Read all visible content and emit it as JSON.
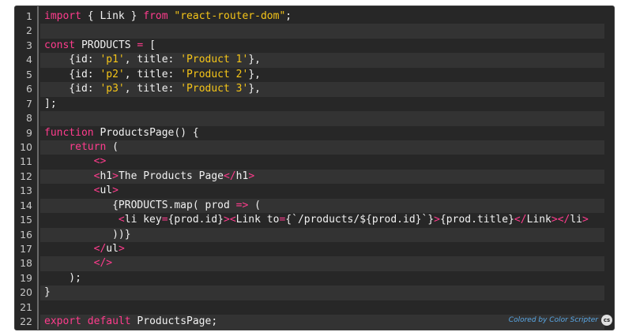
{
  "colors": {
    "background": "#272727",
    "keyword": "#ff3c8d",
    "string": "#f5c518",
    "text": "#f1f1f1",
    "line_number": "#c8c8c8",
    "credit": "#5aa8e6"
  },
  "lines": [
    {
      "n": "1",
      "tokens": [
        [
          "kw",
          "import"
        ],
        [
          "txt",
          " { Link } "
        ],
        [
          "kw",
          "from"
        ],
        [
          "txt",
          " "
        ],
        [
          "str",
          "\"react-router-dom\""
        ],
        [
          "txt",
          ";"
        ]
      ]
    },
    {
      "n": "2",
      "tokens": []
    },
    {
      "n": "3",
      "tokens": [
        [
          "kw",
          "const"
        ],
        [
          "txt",
          " PRODUCTS "
        ],
        [
          "op",
          "="
        ],
        [
          "txt",
          " ["
        ]
      ]
    },
    {
      "n": "4",
      "tokens": [
        [
          "txt",
          "    {id: "
        ],
        [
          "str",
          "'p1'"
        ],
        [
          "txt",
          ", title: "
        ],
        [
          "str",
          "'Product 1'"
        ],
        [
          "txt",
          "},"
        ]
      ]
    },
    {
      "n": "5",
      "tokens": [
        [
          "txt",
          "    {id: "
        ],
        [
          "str",
          "'p2'"
        ],
        [
          "txt",
          ", title: "
        ],
        [
          "str",
          "'Product 2'"
        ],
        [
          "txt",
          "},"
        ]
      ]
    },
    {
      "n": "6",
      "tokens": [
        [
          "txt",
          "    {id: "
        ],
        [
          "str",
          "'p3'"
        ],
        [
          "txt",
          ", title: "
        ],
        [
          "str",
          "'Product 3'"
        ],
        [
          "txt",
          "},"
        ]
      ]
    },
    {
      "n": "7",
      "tokens": [
        [
          "txt",
          "];"
        ]
      ]
    },
    {
      "n": "8",
      "tokens": []
    },
    {
      "n": "9",
      "tokens": [
        [
          "kw",
          "function"
        ],
        [
          "txt",
          " ProductsPage() {"
        ]
      ]
    },
    {
      "n": "10",
      "tokens": [
        [
          "txt",
          "    "
        ],
        [
          "kw",
          "return"
        ],
        [
          "txt",
          " ("
        ]
      ]
    },
    {
      "n": "11",
      "tokens": [
        [
          "txt",
          "        "
        ],
        [
          "op",
          "<>"
        ]
      ]
    },
    {
      "n": "12",
      "tokens": [
        [
          "txt",
          "        "
        ],
        [
          "op",
          "<"
        ],
        [
          "txt",
          "h1"
        ],
        [
          "op",
          ">"
        ],
        [
          "txt",
          "The Products Page"
        ],
        [
          "op",
          "</"
        ],
        [
          "txt",
          "h1"
        ],
        [
          "op",
          ">"
        ]
      ]
    },
    {
      "n": "13",
      "tokens": [
        [
          "txt",
          "        "
        ],
        [
          "op",
          "<"
        ],
        [
          "txt",
          "ul"
        ],
        [
          "op",
          ">"
        ]
      ]
    },
    {
      "n": "14",
      "tokens": [
        [
          "txt",
          "           {PRODUCTS.map( prod "
        ],
        [
          "op",
          "=>"
        ],
        [
          "txt",
          " ("
        ]
      ]
    },
    {
      "n": "15",
      "tokens": [
        [
          "txt",
          "            "
        ],
        [
          "op",
          "<"
        ],
        [
          "txt",
          "li key"
        ],
        [
          "op",
          "="
        ],
        [
          "txt",
          "{prod.id}"
        ],
        [
          "op",
          "><"
        ],
        [
          "txt",
          "Link to"
        ],
        [
          "op",
          "="
        ],
        [
          "txt",
          "{`"
        ],
        [
          "txt",
          "/products/"
        ],
        [
          "txt",
          "${prod.id}"
        ],
        [
          "txt",
          "`}"
        ],
        [
          "op",
          ">"
        ],
        [
          "txt",
          "{prod.title}"
        ],
        [
          "op",
          "</"
        ],
        [
          "txt",
          "Link"
        ],
        [
          "op",
          "></"
        ],
        [
          "txt",
          "li"
        ],
        [
          "op",
          ">"
        ]
      ]
    },
    {
      "n": "16",
      "tokens": [
        [
          "txt",
          "           ))}"
        ]
      ]
    },
    {
      "n": "17",
      "tokens": [
        [
          "txt",
          "        "
        ],
        [
          "op",
          "</"
        ],
        [
          "txt",
          "ul"
        ],
        [
          "op",
          ">"
        ]
      ]
    },
    {
      "n": "18",
      "tokens": [
        [
          "txt",
          "        "
        ],
        [
          "op",
          "</>"
        ]
      ]
    },
    {
      "n": "19",
      "tokens": [
        [
          "txt",
          "    );"
        ]
      ]
    },
    {
      "n": "20",
      "tokens": [
        [
          "txt",
          "}"
        ]
      ]
    },
    {
      "n": "21",
      "tokens": []
    },
    {
      "n": "22",
      "tokens": [
        [
          "kw",
          "export"
        ],
        [
          "txt",
          " "
        ],
        [
          "kw",
          "default"
        ],
        [
          "txt",
          " ProductsPage;"
        ]
      ]
    }
  ],
  "footer": {
    "credit": "Colored by Color Scripter",
    "badge": "cs"
  }
}
